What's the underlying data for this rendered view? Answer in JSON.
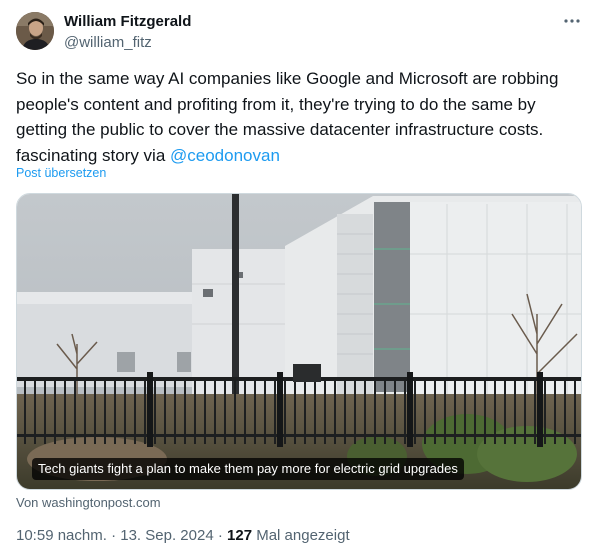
{
  "author": {
    "name": "William Fitzgerald",
    "handle": "@william_fitz"
  },
  "tweet": {
    "text": "So in the same way AI companies like Google and Microsoft are robbing people's content and profiting from it, they're trying to do the same by getting the public to cover the massive datacenter infrastructure costs. fascinating story via ",
    "mention": "@ceodonovan",
    "translate_label": "Post übersetzen"
  },
  "link_card": {
    "headline": "Tech giants fight a plan to make them pay more for electric grid upgrades",
    "source": "Von washingtonpost.com"
  },
  "meta": {
    "time": "10:59 nachm.",
    "separator": " · ",
    "date": "13. Sep. 2024",
    "views_count": "127",
    "views_label": " Mal angezeigt"
  },
  "icons": {
    "more": "more-horizontal-icon"
  },
  "colors": {
    "accent": "#1d9bf0",
    "text": "#0f1419",
    "muted": "#536471",
    "border": "#cfd9de"
  }
}
